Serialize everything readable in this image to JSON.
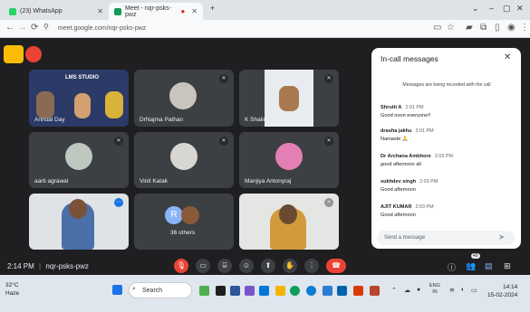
{
  "browser": {
    "tabs": [
      {
        "label": "(23) WhatsApp",
        "active": false
      },
      {
        "label": "Meet - nqr-psks-pwz",
        "active": true
      }
    ],
    "url": "meet.google.com/nqr-psks-pwz"
  },
  "tiles": [
    {
      "name": "Annual Day",
      "banner": "LMS STUDIO"
    },
    {
      "name": "DrNajma Pathan"
    },
    {
      "name": "K Shalini"
    },
    {
      "name": "aarti agrawal"
    },
    {
      "name": "Vinit Katak"
    },
    {
      "name": "Manjiya Antonyraj"
    },
    {
      "name": ""
    },
    {
      "name": "36 others",
      "avatar_letter": "R"
    },
    {
      "name": ""
    }
  ],
  "chat": {
    "title": "In-call messages",
    "notice": "Messages are being recorded with the call",
    "messages": [
      {
        "sender": "Shrutti A",
        "time": "2:01 PM",
        "text": "Good noon everyone!!"
      },
      {
        "sender": "drasha jakhu",
        "time": "2:01 PM",
        "text": "Namaste 🙏"
      },
      {
        "sender": "Dr Archana Ambhore",
        "time": "2:03 PM",
        "text": "good afternoon all"
      },
      {
        "sender": "sukhdev singh",
        "time": "2:03 PM",
        "text": "Good afternoon"
      },
      {
        "sender": "AJIT KUMAR",
        "time": "2:03 PM",
        "text": "Good afternoon"
      }
    ],
    "input_placeholder": "Send a message"
  },
  "meeting": {
    "time": "2:14 PM",
    "code": "nqr-psks-pwz",
    "participants_badge": "40"
  },
  "taskbar": {
    "temp": "32°C",
    "weather": "Haze",
    "search": "Search",
    "lang": "ENG",
    "region": "IN",
    "clock_time": "14:14",
    "clock_date": "15-02-2024"
  }
}
